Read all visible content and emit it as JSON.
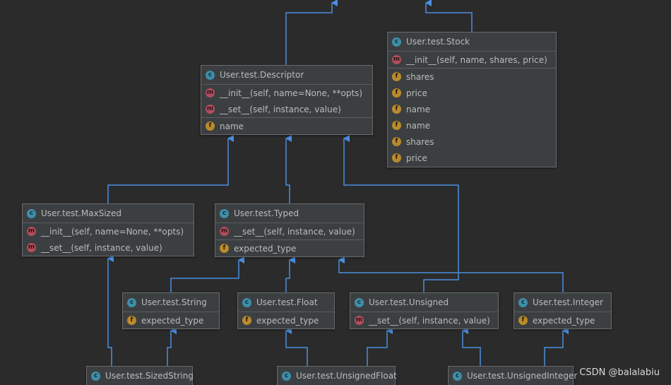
{
  "classes": {
    "stock": {
      "title": "User.test.Stock",
      "members": [
        {
          "kind": "m",
          "label": "__init__(self, name, shares, price)"
        },
        {
          "kind": "f",
          "label": "shares"
        },
        {
          "kind": "f",
          "label": "price"
        },
        {
          "kind": "f",
          "label": "name"
        },
        {
          "kind": "f",
          "label": "name"
        },
        {
          "kind": "f",
          "label": "shares"
        },
        {
          "kind": "f",
          "label": "price"
        }
      ]
    },
    "descriptor": {
      "title": "User.test.Descriptor",
      "members": [
        {
          "kind": "m",
          "label": "__init__(self, name=None, **opts)"
        },
        {
          "kind": "m",
          "label": "__set__(self, instance, value)"
        },
        {
          "kind": "f",
          "label": "name"
        }
      ]
    },
    "maxsized": {
      "title": "User.test.MaxSized",
      "members": [
        {
          "kind": "m",
          "label": "__init__(self, name=None, **opts)"
        },
        {
          "kind": "m",
          "label": "__set__(self, instance, value)"
        }
      ]
    },
    "typed": {
      "title": "User.test.Typed",
      "members": [
        {
          "kind": "m",
          "label": "__set__(self, instance, value)"
        },
        {
          "kind": "f",
          "label": "expected_type"
        }
      ]
    },
    "string": {
      "title": "User.test.String",
      "members": [
        {
          "kind": "f",
          "label": "expected_type"
        }
      ]
    },
    "float": {
      "title": "User.test.Float",
      "members": [
        {
          "kind": "f",
          "label": "expected_type"
        }
      ]
    },
    "unsigned": {
      "title": "User.test.Unsigned",
      "members": [
        {
          "kind": "m",
          "label": "__set__(self, instance, value)"
        }
      ]
    },
    "integer": {
      "title": "User.test.Integer",
      "members": [
        {
          "kind": "f",
          "label": "expected_type"
        }
      ]
    },
    "sizedstring": {
      "title": "User.test.SizedString",
      "members": []
    },
    "unsignedfloat": {
      "title": "User.test.UnsignedFloat",
      "members": []
    },
    "unsignedinteger": {
      "title": "User.test.UnsignedInteger",
      "members": []
    }
  },
  "icons": {
    "class": "c",
    "method": "m",
    "field": "f"
  },
  "colors": {
    "background": "#2b2b2b",
    "edge": "#4a8fe0",
    "class_icon": "#3d8fab",
    "method_icon": "#b14e5d",
    "field_icon": "#b98b2a"
  },
  "watermark": "CSDN @balalabiu"
}
